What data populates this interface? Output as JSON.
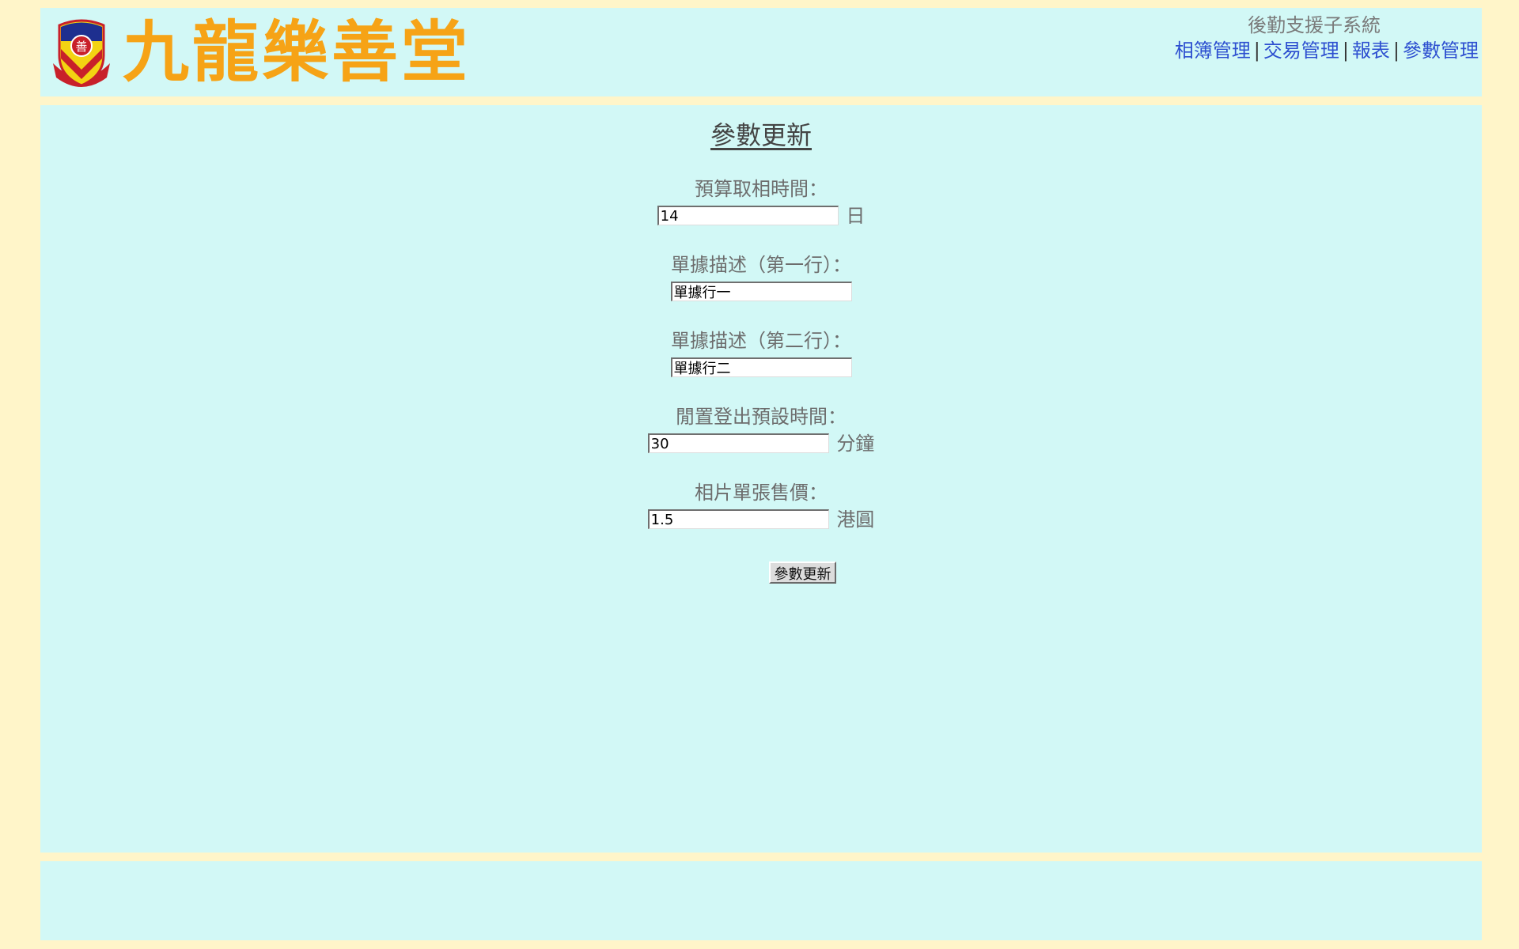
{
  "header": {
    "logo_text": "九龍樂善堂",
    "emblem_char": "善",
    "system_title": "後勤支援子系統",
    "nav": [
      {
        "label": "相簿管理"
      },
      {
        "label": "交易管理"
      },
      {
        "label": "報表"
      },
      {
        "label": "參數管理"
      }
    ],
    "nav_separator": "|",
    "colors": {
      "logo": "#f6a316",
      "link": "#2d4fd0",
      "panel": "#d2f8f6",
      "page_bg": "#fff5c9"
    }
  },
  "main": {
    "title": "參數更新",
    "fields": [
      {
        "label": "預算取相時間：",
        "value": "14",
        "unit": "日"
      },
      {
        "label": "單據描述（第一行）：",
        "value": "單據行一",
        "unit": ""
      },
      {
        "label": "單據描述（第二行）：",
        "value": "單據行二",
        "unit": ""
      },
      {
        "label": "閒置登出預設時間：",
        "value": "30",
        "unit": "分鐘"
      },
      {
        "label": "相片單張售價：",
        "value": "1.5",
        "unit": "港圓"
      }
    ],
    "submit_label": "參數更新"
  }
}
